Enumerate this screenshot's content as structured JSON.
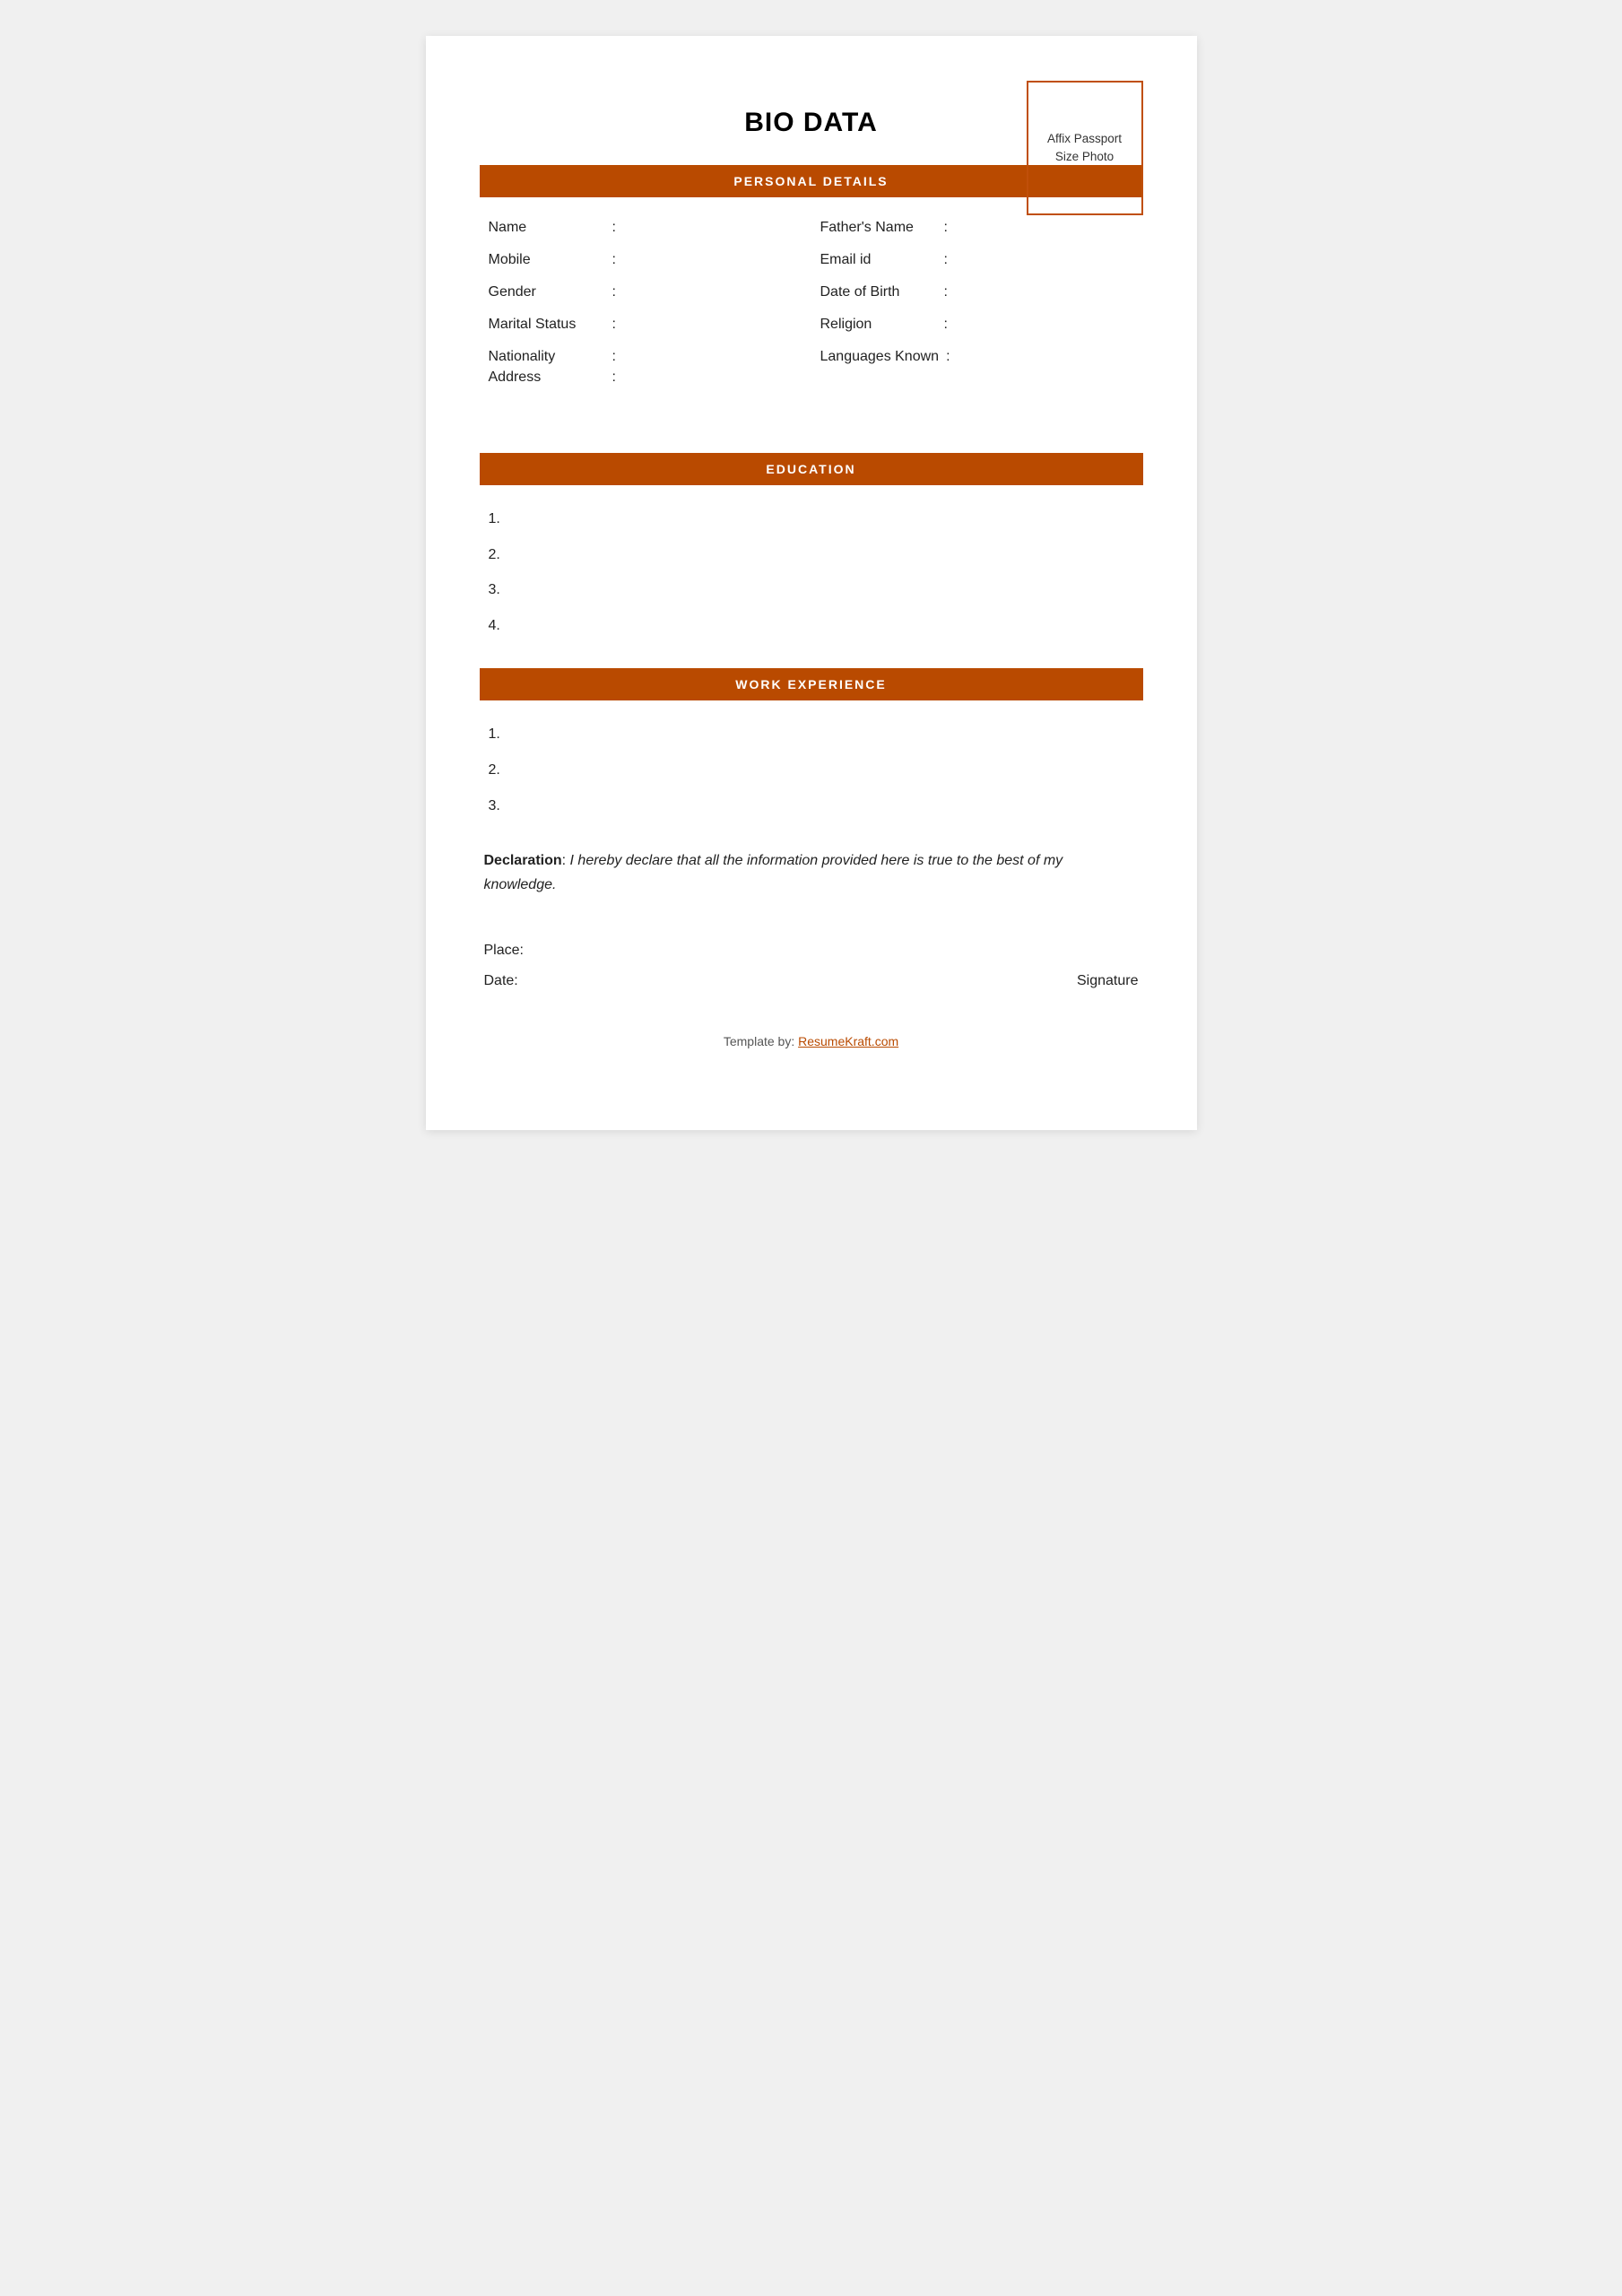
{
  "header": {
    "title": "BIO DATA",
    "photo_box_text": "Affix Passport Size Photo"
  },
  "sections": {
    "personal_details": {
      "heading": "PERSONAL DETAILS",
      "fields_left": [
        {
          "label": "Name",
          "colon": ":"
        },
        {
          "label": "Mobile",
          "colon": ":"
        },
        {
          "label": "Gender",
          "colon": ":"
        },
        {
          "label": "Marital Status",
          "colon": ":"
        },
        {
          "label": "Nationality",
          "colon": ":"
        }
      ],
      "fields_right": [
        {
          "label": "Father's Name",
          "colon": ":"
        },
        {
          "label": "Email id",
          "colon": ":"
        },
        {
          "label": "Date of Birth",
          "colon": ":"
        },
        {
          "label": "Religion",
          "colon": ":"
        },
        {
          "label": "Languages Known",
          "colon": ":"
        }
      ],
      "address_label": "Address",
      "address_colon": ":"
    },
    "education": {
      "heading": "EDUCATION",
      "items": [
        "1.",
        "2.",
        "3.",
        "4."
      ]
    },
    "work_experience": {
      "heading": "WORK EXPERIENCE",
      "items": [
        "1.",
        "2.",
        "3."
      ]
    },
    "declaration": {
      "label": "Declaration",
      "colon": ":",
      "text": " I hereby declare that all the information provided here is true to the best of my knowledge."
    },
    "place_date": {
      "place_label": "Place:",
      "date_label": "Date:",
      "signature_label": "Signature"
    }
  },
  "footer": {
    "text": "Template by: ",
    "link_text": "ResumeKraft.com",
    "link_url": "#"
  }
}
